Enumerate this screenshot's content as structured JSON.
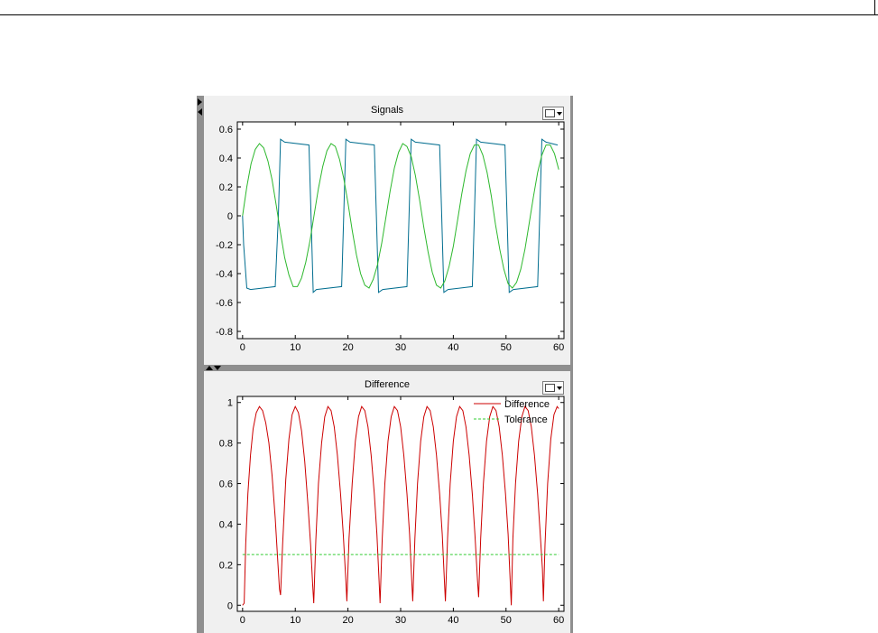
{
  "chart_data": [
    {
      "type": "line",
      "title": "Signals",
      "xlabel": "",
      "ylabel": "",
      "xlim": [
        -1,
        61
      ],
      "ylim": [
        -0.85,
        0.65
      ],
      "xticks": [
        0,
        10,
        20,
        30,
        40,
        50,
        60
      ],
      "yticks": [
        0.6,
        0.4,
        0.2,
        0,
        -0.2,
        -0.4,
        -0.6,
        -0.8
      ],
      "ytick_labels": [
        "0.6",
        "0.4",
        "0.2",
        "0",
        "-0.2",
        "-0.4",
        "-0.6",
        "-0.8"
      ],
      "grid": false,
      "series": [
        {
          "color": "#006d8f",
          "x": [
            0,
            0.2,
            0.8,
            1.5,
            6.2,
            6.8,
            7.2,
            8.0,
            12.6,
            13.0,
            13.4,
            14.0,
            18.8,
            19.2,
            19.6,
            20.4,
            25.0,
            25.4,
            25.8,
            26.6,
            31.2,
            31.6,
            32.0,
            32.8,
            37.4,
            37.8,
            38.2,
            39.0,
            43.6,
            44.0,
            44.4,
            45.2,
            49.8,
            50.2,
            50.6,
            51.4,
            56.0,
            56.4,
            56.8,
            57.6,
            59.8
          ],
          "y": [
            0,
            -0.2,
            -0.5,
            -0.51,
            -0.49,
            0.0,
            0.53,
            0.51,
            0.49,
            0.0,
            -0.53,
            -0.51,
            -0.49,
            0.0,
            0.53,
            0.51,
            0.49,
            0.0,
            -0.53,
            -0.51,
            -0.49,
            0.0,
            0.53,
            0.51,
            0.49,
            0.0,
            -0.53,
            -0.51,
            -0.49,
            0.0,
            0.53,
            0.51,
            0.49,
            0.0,
            -0.53,
            -0.51,
            -0.49,
            0.0,
            0.53,
            0.51,
            0.49
          ]
        },
        {
          "color": "#2db82d",
          "x": [
            0,
            0.8,
            1.6,
            2.4,
            3.2,
            4.0,
            4.8,
            5.6,
            6.4,
            7.2,
            8.0,
            8.8,
            9.6,
            10.4,
            11.2,
            12.0,
            12.8,
            13.6,
            14.4,
            15.2,
            16.0,
            16.8,
            17.6,
            18.4,
            19.2,
            20.0,
            20.8,
            21.6,
            22.4,
            23.2,
            24.0,
            24.8,
            25.6,
            26.4,
            27.2,
            28.0,
            28.8,
            29.6,
            30.4,
            31.2,
            32.0,
            32.8,
            33.6,
            34.4,
            35.2,
            36.0,
            36.8,
            37.6,
            38.4,
            39.2,
            40.0,
            40.8,
            41.6,
            42.4,
            43.2,
            44.0,
            44.8,
            45.6,
            46.4,
            47.2,
            48.0,
            48.8,
            49.6,
            50.4,
            51.2,
            52.0,
            52.8,
            53.6,
            54.4,
            55.2,
            56.0,
            56.8,
            57.6,
            58.4,
            59.2,
            60.0
          ],
          "y": [
            0.0,
            0.2,
            0.36,
            0.46,
            0.5,
            0.47,
            0.38,
            0.25,
            0.07,
            -0.12,
            -0.29,
            -0.41,
            -0.49,
            -0.49,
            -0.43,
            -0.32,
            -0.17,
            0.01,
            0.19,
            0.34,
            0.45,
            0.5,
            0.48,
            0.39,
            0.26,
            0.09,
            -0.1,
            -0.27,
            -0.4,
            -0.48,
            -0.5,
            -0.44,
            -0.34,
            -0.19,
            -0.01,
            0.17,
            0.33,
            0.44,
            0.5,
            0.48,
            0.41,
            0.28,
            0.11,
            -0.08,
            -0.25,
            -0.39,
            -0.48,
            -0.5,
            -0.45,
            -0.35,
            -0.21,
            -0.03,
            0.15,
            0.31,
            0.43,
            0.49,
            0.49,
            0.42,
            0.3,
            0.14,
            -0.06,
            -0.23,
            -0.37,
            -0.47,
            -0.5,
            -0.46,
            -0.37,
            -0.23,
            -0.05,
            0.13,
            0.3,
            0.42,
            0.49,
            0.49,
            0.43,
            0.32
          ]
        }
      ]
    },
    {
      "type": "line",
      "title": "Difference",
      "xlabel": "",
      "ylabel": "",
      "xlim": [
        -1,
        61
      ],
      "ylim": [
        -0.03,
        1.03
      ],
      "xticks": [
        0,
        10,
        20,
        30,
        40,
        50,
        60
      ],
      "yticks": [
        1,
        0.8,
        0.6,
        0.4,
        0.2,
        0
      ],
      "ytick_labels": [
        "1",
        "0.8",
        "0.6",
        "0.4",
        "0.2",
        "0"
      ],
      "grid": false,
      "legend": "top-right",
      "series": [
        {
          "name": "Difference",
          "color": "#cc0000",
          "x": [
            0,
            0.3,
            0.6,
            1.0,
            1.5,
            2.0,
            2.6,
            3.2,
            3.8,
            4.4,
            5.0,
            5.6,
            6.2,
            6.6,
            7.0,
            7.2,
            7.6,
            8.2,
            8.8,
            9.4,
            10.0,
            10.6,
            11.2,
            11.8,
            12.4,
            12.9,
            13.3,
            13.5,
            13.9,
            14.4,
            15.0,
            15.6,
            16.2,
            16.8,
            17.4,
            18.0,
            18.6,
            19.1,
            19.6,
            19.8,
            20.2,
            20.8,
            21.4,
            22.0,
            22.6,
            23.2,
            23.8,
            24.4,
            25.0,
            25.5,
            25.9,
            26.1,
            26.5,
            27.0,
            27.6,
            28.2,
            28.8,
            29.4,
            30.0,
            30.6,
            31.2,
            31.7,
            32.1,
            32.3,
            32.7,
            33.2,
            33.8,
            34.4,
            35.0,
            35.6,
            36.2,
            36.8,
            37.4,
            37.9,
            38.3,
            38.5,
            38.9,
            39.4,
            40.0,
            40.6,
            41.2,
            41.8,
            42.4,
            43.0,
            43.6,
            44.1,
            44.6,
            44.8,
            45.2,
            45.7,
            46.3,
            46.9,
            47.5,
            48.1,
            48.7,
            49.3,
            49.9,
            50.4,
            50.8,
            51.0,
            51.3,
            51.8,
            52.4,
            53.0,
            53.6,
            54.2,
            54.8,
            55.4,
            56.0,
            56.5,
            56.9,
            57.1,
            57.4,
            57.9,
            58.5,
            59.1,
            59.7,
            60.0
          ],
          "y": [
            0.0,
            0.01,
            0.3,
            0.55,
            0.74,
            0.87,
            0.95,
            0.98,
            0.96,
            0.9,
            0.8,
            0.64,
            0.43,
            0.25,
            0.08,
            0.05,
            0.3,
            0.62,
            0.82,
            0.94,
            0.98,
            0.95,
            0.86,
            0.71,
            0.5,
            0.3,
            0.1,
            0.01,
            0.32,
            0.6,
            0.8,
            0.93,
            0.98,
            0.96,
            0.88,
            0.74,
            0.55,
            0.35,
            0.12,
            0.02,
            0.33,
            0.6,
            0.81,
            0.93,
            0.98,
            0.96,
            0.88,
            0.74,
            0.55,
            0.35,
            0.12,
            0.01,
            0.33,
            0.6,
            0.81,
            0.93,
            0.98,
            0.96,
            0.88,
            0.74,
            0.55,
            0.35,
            0.12,
            0.02,
            0.33,
            0.6,
            0.81,
            0.93,
            0.98,
            0.96,
            0.88,
            0.74,
            0.55,
            0.35,
            0.12,
            0.02,
            0.33,
            0.6,
            0.81,
            0.93,
            0.98,
            0.96,
            0.88,
            0.74,
            0.55,
            0.35,
            0.12,
            0.04,
            0.33,
            0.6,
            0.81,
            0.93,
            0.98,
            0.96,
            0.88,
            0.74,
            0.55,
            0.35,
            0.12,
            0.0,
            0.33,
            0.6,
            0.81,
            0.93,
            0.98,
            0.96,
            0.88,
            0.74,
            0.55,
            0.35,
            0.18,
            0.02,
            0.3,
            0.6,
            0.82,
            0.94,
            0.98,
            0.97
          ]
        },
        {
          "name": "Tolerance",
          "color": "#33cc33",
          "dashed": true,
          "x": [
            0,
            60
          ],
          "y": [
            0.25,
            0.25
          ]
        }
      ]
    }
  ]
}
